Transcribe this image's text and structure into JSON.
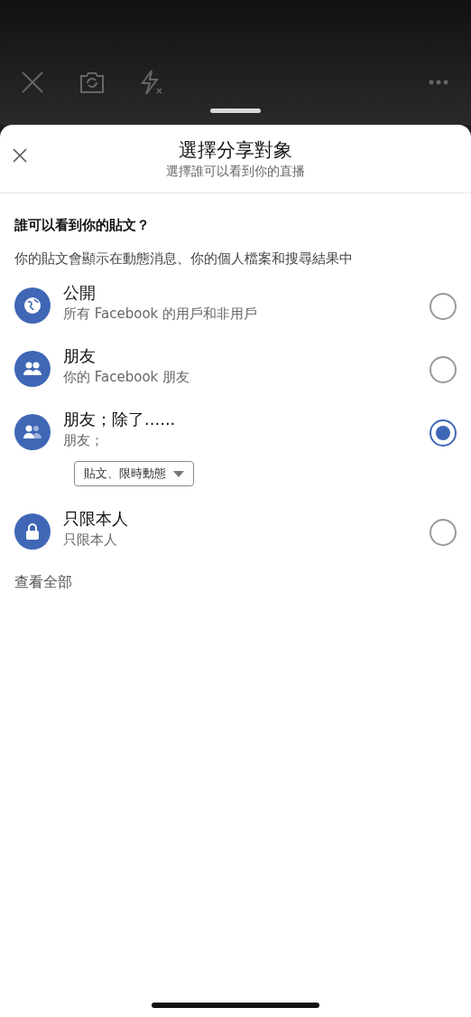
{
  "camera_toolbar": {
    "buttons": [
      {
        "kind": "close"
      },
      {
        "kind": "flip-camera"
      },
      {
        "kind": "flash-off"
      },
      {
        "kind": "more"
      }
    ]
  },
  "sheet": {
    "title": "選擇分享對象",
    "subtitle": "選擇誰可以看到你的直播"
  },
  "section": {
    "heading": "誰可以看到你的貼文？",
    "description": "你的貼文會顯示在動態消息、你的個人檔案和搜尋結果中"
  },
  "options": [
    {
      "kind": "public",
      "title": "公開",
      "subtitle": "所有 Facebook 的用戶和非用戶",
      "selected": false
    },
    {
      "kind": "friends",
      "title": "朋友",
      "subtitle": "你的 Facebook 朋友",
      "selected": false
    },
    {
      "kind": "friends-except",
      "title": "朋友；除了......",
      "subtitle": "朋友；",
      "dropdown": "貼文、限時動態",
      "selected": true
    },
    {
      "kind": "only-me",
      "title": "只限本人",
      "subtitle": "只限本人",
      "selected": false
    }
  ],
  "see_all": "查看全部"
}
